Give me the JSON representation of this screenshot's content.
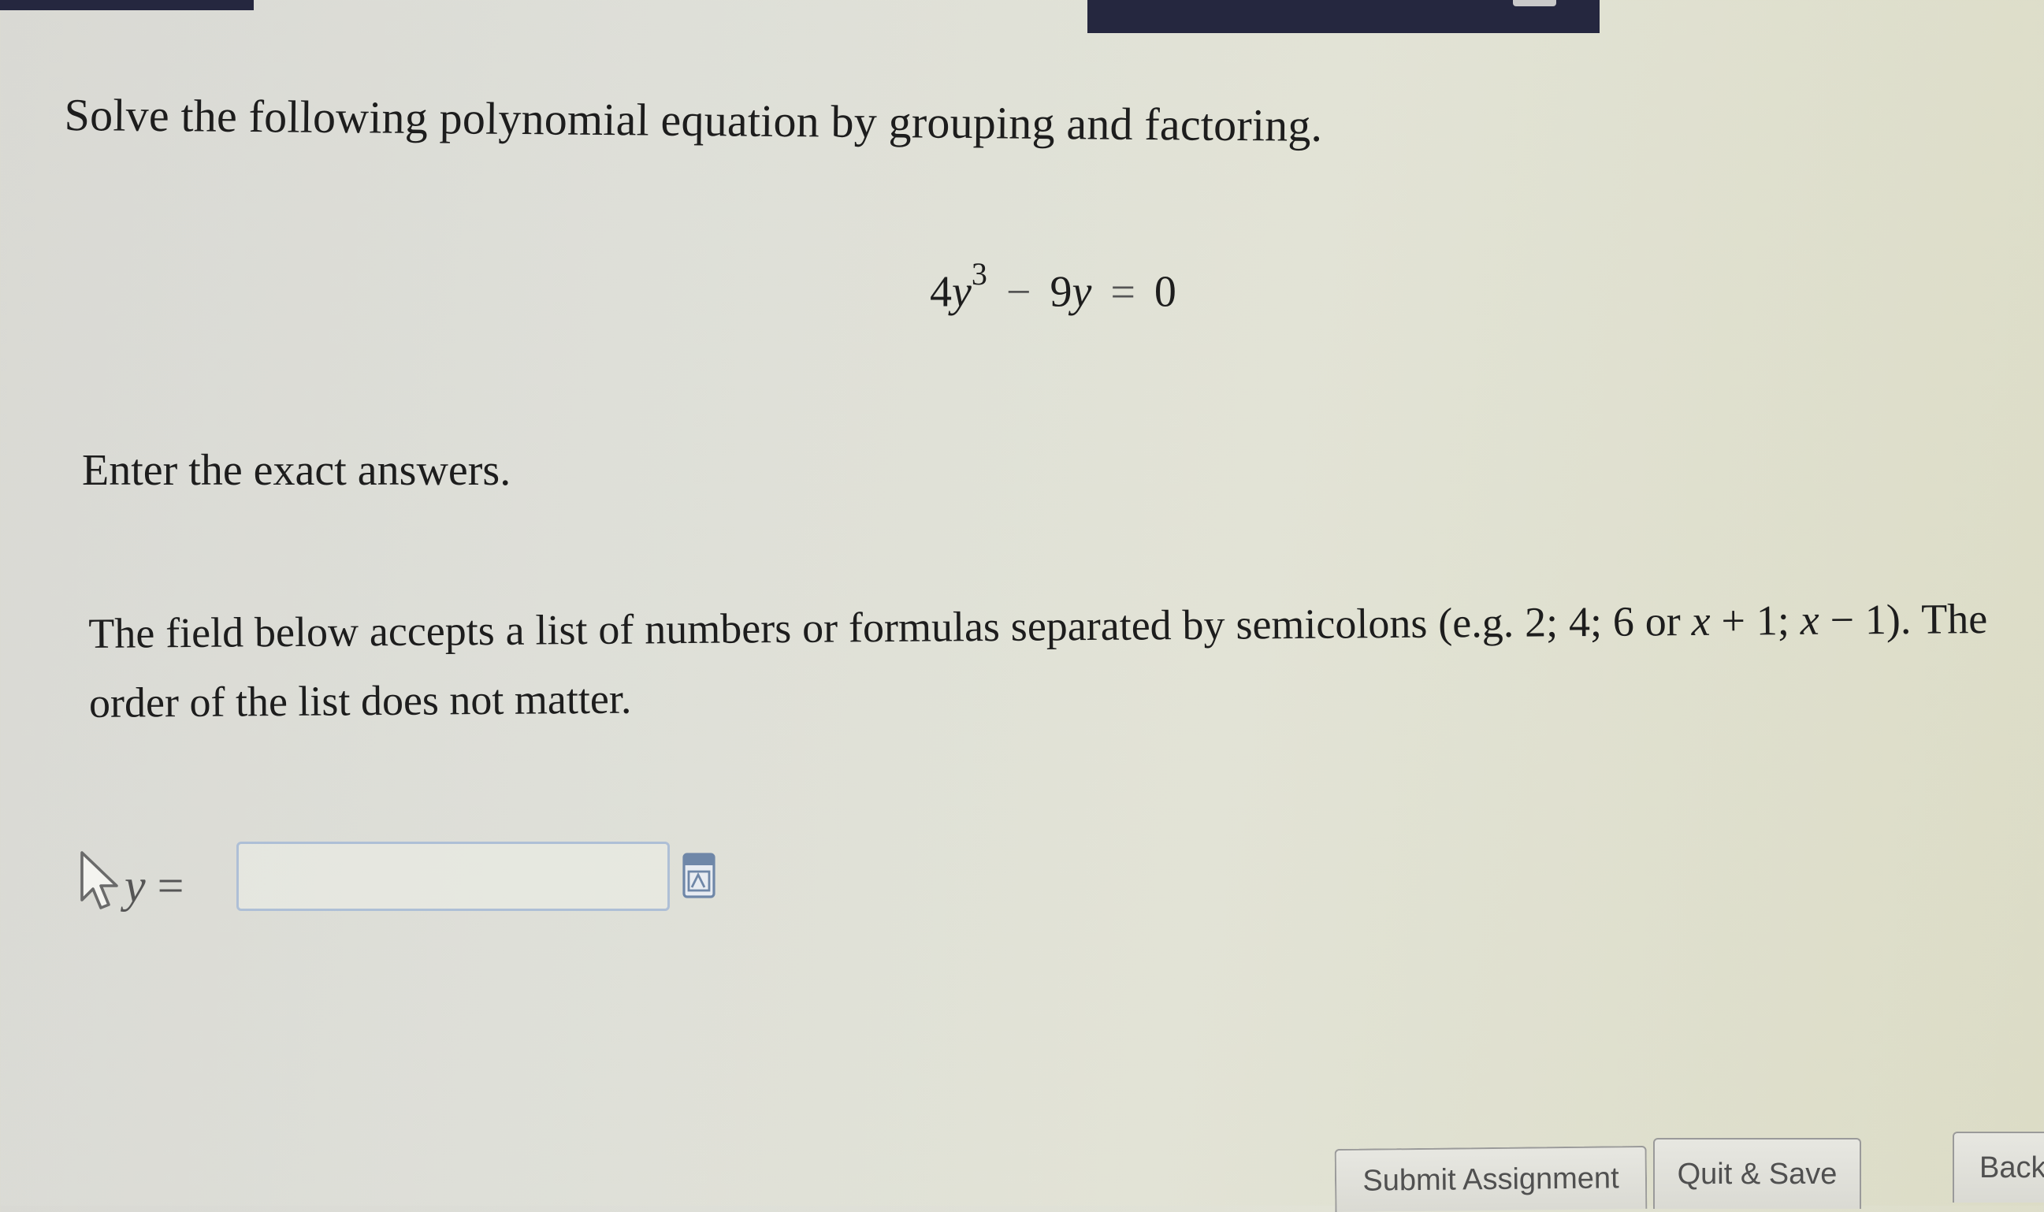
{
  "question": {
    "instruction": "Solve the following polynomial equation by grouping and factoring.",
    "equation": {
      "coef1": "4",
      "var1": "y",
      "exponent": "3",
      "minus": "−",
      "coef2": "9",
      "var2": "y",
      "equals": "=",
      "rhs": "0"
    },
    "exact_prompt": "Enter the exact answers.",
    "field_description": {
      "text": "The field below accepts a list of numbers or formulas separated by semicolons (e.g. 2; 4; 6 or ",
      "math_part1": "x",
      "math_plus": " + 1; ",
      "math_part2": "x",
      "math_minus": " − 1",
      "tail": "). The order of the list does not matter."
    }
  },
  "answer": {
    "variable": "y",
    "equals": "=",
    "value": ""
  },
  "icons": {
    "cursor": "arrow-cursor-icon",
    "editor": "equation-editor-icon"
  },
  "buttons": {
    "submit": "Submit Assignment",
    "quit": "Quit & Save",
    "back": "Back"
  },
  "colors": {
    "header_bar": "#25273f",
    "input_border": "#aebfd6",
    "button_border": "#9a9a9a"
  }
}
